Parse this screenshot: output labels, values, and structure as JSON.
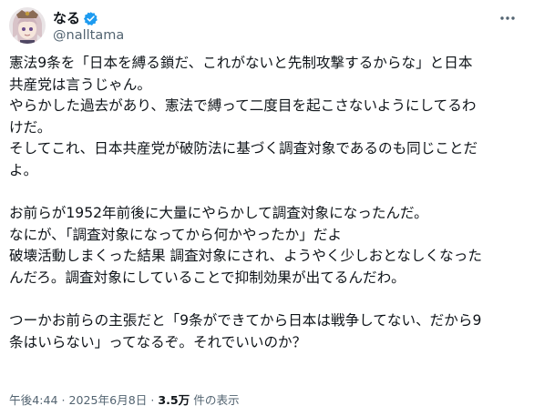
{
  "author": {
    "display_name": "なる",
    "handle": "@nalltama",
    "verified": true
  },
  "tweet": {
    "lines": [
      "憲法9条を「日本を縛る鎖だ、これがないと先制攻撃するからな」と日本",
      "共産党は言うじゃん。",
      "やらかした過去があり、憲法で縛って二度目を起こさないようにしてるわ",
      "けだ。",
      "そしてこれ、日本共産党が破防法に基づく調査対象であるのも同じことだ",
      "よ。",
      "",
      "お前らが1952年前後に大量にやらかして調査対象になったんだ。",
      "なにが、「調査対象になってから何かやったか」だよ",
      "破壊活動しまくった結果 調査対象にされ、ようやく少しおとなしくなった",
      "んだろ。調査対象にしていることで抑制効果が出てるんだわ。",
      "",
      "つーかお前らの主張だと「9条ができてから日本は戦争してない、だから9",
      "条はいらない」ってなるぞ。それでいいのか？"
    ]
  },
  "meta": {
    "time": "午後4:44",
    "separator": " · ",
    "date": "2025年6月8日",
    "views_count": "3.5万",
    "views_label": " 件の表示"
  },
  "colors": {
    "verified": "#1d9bf0",
    "secondary_text": "#536471"
  },
  "icons": {
    "verified": "verified-badge-icon",
    "more": "more-options-icon"
  }
}
